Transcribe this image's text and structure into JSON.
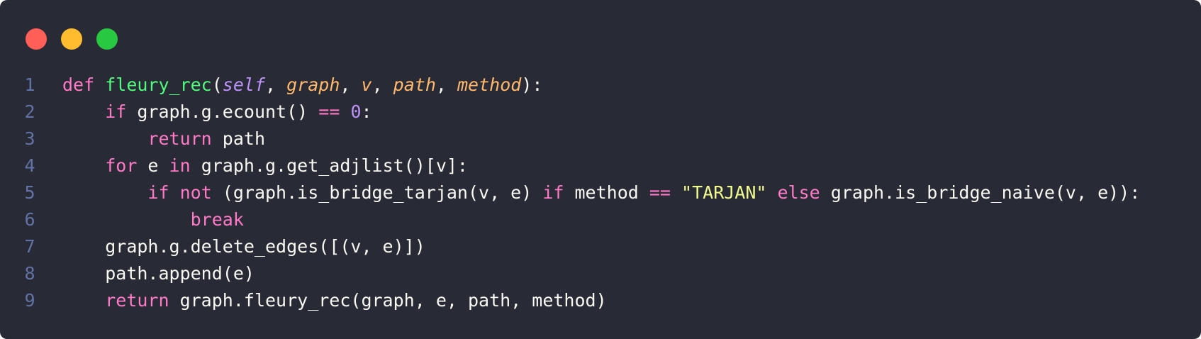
{
  "window": {
    "controls": [
      {
        "name": "close",
        "color": "#ff5f57"
      },
      {
        "name": "minimize",
        "color": "#febc2e"
      },
      {
        "name": "maximize",
        "color": "#28c840"
      }
    ]
  },
  "theme": {
    "background": "#282a36",
    "text": "#f8f8f2",
    "keyword": "#ff79c6",
    "function": "#50fa7b",
    "self": "#bd93f9",
    "param": "#ffb86c",
    "number": "#bd93f9",
    "string": "#f1fa8c",
    "line_number": "#6272a4"
  },
  "code": {
    "lines": [
      {
        "num": "1",
        "indent": "",
        "tokens": [
          {
            "t": "def",
            "c": "kw"
          },
          {
            "t": " ",
            "c": ""
          },
          {
            "t": "fleury_rec",
            "c": "fn"
          },
          {
            "t": "(",
            "c": ""
          },
          {
            "t": "self",
            "c": "self"
          },
          {
            "t": ", ",
            "c": ""
          },
          {
            "t": "graph",
            "c": "param"
          },
          {
            "t": ", ",
            "c": ""
          },
          {
            "t": "v",
            "c": "param"
          },
          {
            "t": ", ",
            "c": ""
          },
          {
            "t": "path",
            "c": "param"
          },
          {
            "t": ", ",
            "c": ""
          },
          {
            "t": "method",
            "c": "param"
          },
          {
            "t": "):",
            "c": ""
          }
        ]
      },
      {
        "num": "2",
        "indent": "    ",
        "tokens": [
          {
            "t": "if",
            "c": "kw"
          },
          {
            "t": " graph.g.ecount() ",
            "c": ""
          },
          {
            "t": "==",
            "c": "op"
          },
          {
            "t": " ",
            "c": ""
          },
          {
            "t": "0",
            "c": "num"
          },
          {
            "t": ":",
            "c": ""
          }
        ]
      },
      {
        "num": "3",
        "indent": "        ",
        "tokens": [
          {
            "t": "return",
            "c": "kw"
          },
          {
            "t": " path",
            "c": ""
          }
        ]
      },
      {
        "num": "4",
        "indent": "    ",
        "tokens": [
          {
            "t": "for",
            "c": "kw"
          },
          {
            "t": " e ",
            "c": ""
          },
          {
            "t": "in",
            "c": "kw"
          },
          {
            "t": " graph.g.get_adjlist()[v]:",
            "c": ""
          }
        ]
      },
      {
        "num": "5",
        "indent": "        ",
        "tokens": [
          {
            "t": "if",
            "c": "kw"
          },
          {
            "t": " ",
            "c": ""
          },
          {
            "t": "not",
            "c": "kw"
          },
          {
            "t": " (graph.is_bridge_tarjan(v, e) ",
            "c": ""
          },
          {
            "t": "if",
            "c": "kw"
          },
          {
            "t": " method ",
            "c": ""
          },
          {
            "t": "==",
            "c": "op"
          },
          {
            "t": " ",
            "c": ""
          },
          {
            "t": "\"TARJAN\"",
            "c": "str"
          },
          {
            "t": " ",
            "c": ""
          },
          {
            "t": "else",
            "c": "kw"
          },
          {
            "t": " graph.is_bridge_naive(v, e)):",
            "c": ""
          }
        ]
      },
      {
        "num": "6",
        "indent": "            ",
        "tokens": [
          {
            "t": "break",
            "c": "kw"
          }
        ]
      },
      {
        "num": "7",
        "indent": "    ",
        "tokens": [
          {
            "t": "graph.g.delete_edges([(v, e)])",
            "c": ""
          }
        ]
      },
      {
        "num": "8",
        "indent": "    ",
        "tokens": [
          {
            "t": "path.append(e)",
            "c": ""
          }
        ]
      },
      {
        "num": "9",
        "indent": "    ",
        "tokens": [
          {
            "t": "return",
            "c": "kw"
          },
          {
            "t": " graph.fleury_rec(graph, e, path, method)",
            "c": ""
          }
        ]
      }
    ]
  }
}
